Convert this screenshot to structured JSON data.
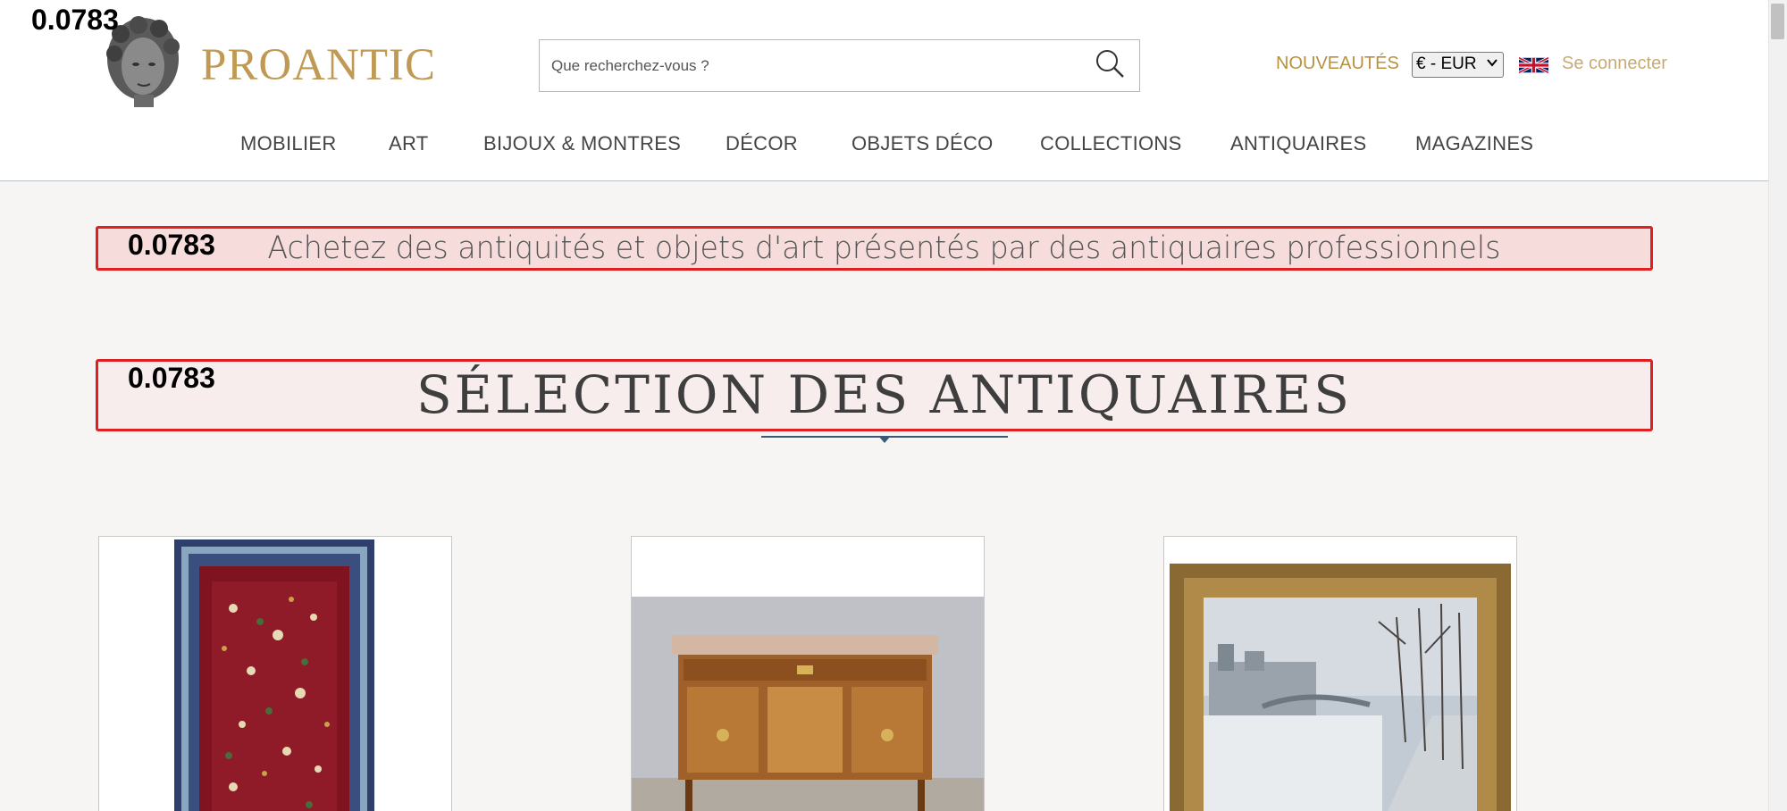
{
  "overlay": {
    "score_top": "0.0783",
    "score_tagline": "0.0783",
    "score_section": "0.0783"
  },
  "header": {
    "brand": "PROANTIC",
    "search_placeholder": "Que recherchez-vous ?",
    "new_label": "NOUVEAUTÉS",
    "currency_selected": "€ - EUR",
    "login_label": "Se connecter",
    "nav": [
      "MOBILIER",
      "ART",
      "BIJOUX & MONTRES",
      "DÉCOR",
      "OBJETS DÉCO",
      "COLLECTIONS",
      "ANTIQUAIRES",
      "MAGAZINES"
    ]
  },
  "main": {
    "tagline": "Achetez des antiquités et objets d'art présentés par des antiquaires professionnels",
    "section_title": "SÉLECTION DES ANTIQUAIRES"
  },
  "icons": {
    "search": "search-icon",
    "flag": "uk-flag-icon",
    "logo": "statue-head-logo"
  },
  "colors": {
    "brand": "#c09a55",
    "highlight_border": "#e02020",
    "rule": "#3a5a74"
  }
}
